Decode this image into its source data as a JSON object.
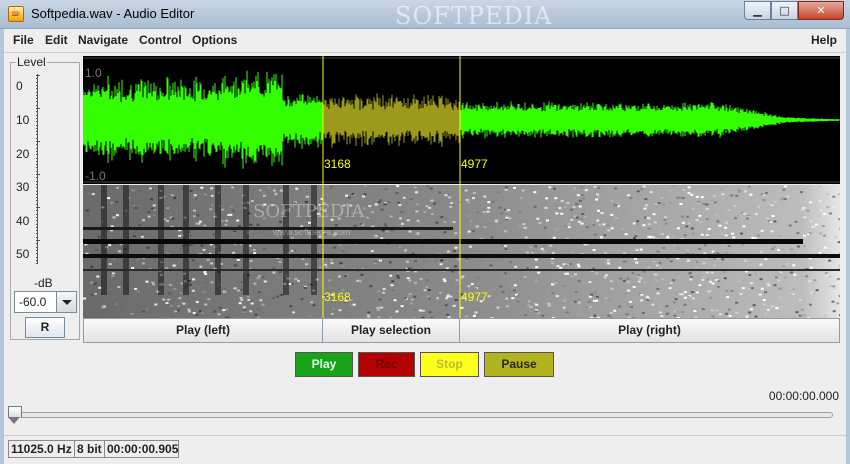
{
  "window": {
    "title": "Softpedia.wav - Audio Editor",
    "watermark": "SOFTPEDIA",
    "controls": {
      "minimize": "▁",
      "maximize": "□",
      "close": "✕"
    }
  },
  "menu": {
    "left": [
      "File",
      "Edit",
      "Navigate",
      "Control",
      "Options"
    ],
    "right": "Help"
  },
  "level_meter": {
    "title": "Level",
    "ticks": [
      "0",
      "10",
      "20",
      "30",
      "40",
      "50"
    ],
    "unit": "-dB",
    "db_value": "-60.0",
    "reset_label": "R"
  },
  "waveform": {
    "top_label": "1.0",
    "bottom_label": "-1.0",
    "selection_start": "3168",
    "selection_end": "4977",
    "colors": {
      "wave": "#33ff00",
      "selection": "#9c9a1c",
      "cursor": "#ffff00"
    }
  },
  "spectrogram": {
    "watermark": "SOFTPEDIA",
    "watermark_url": "www.softpedia.com",
    "selection_start": "3168",
    "selection_end": "4977"
  },
  "play_buttons": {
    "left": "Play (left)",
    "selection": "Play selection",
    "right": "Play (right)"
  },
  "transport": {
    "play": "Play",
    "rec": "Rec",
    "stop": "Stop",
    "pause": "Pause",
    "colors": {
      "play": "#19a319",
      "rec": "#b30000",
      "stop": "#ffff1e",
      "pause": "#b3b31e"
    }
  },
  "position": {
    "time": "00:00:00.000",
    "slider_position": 0
  },
  "status": {
    "sample_rate": "11025.0 Hz",
    "bit_depth": "8 bit",
    "duration": "00:00:00.905"
  }
}
